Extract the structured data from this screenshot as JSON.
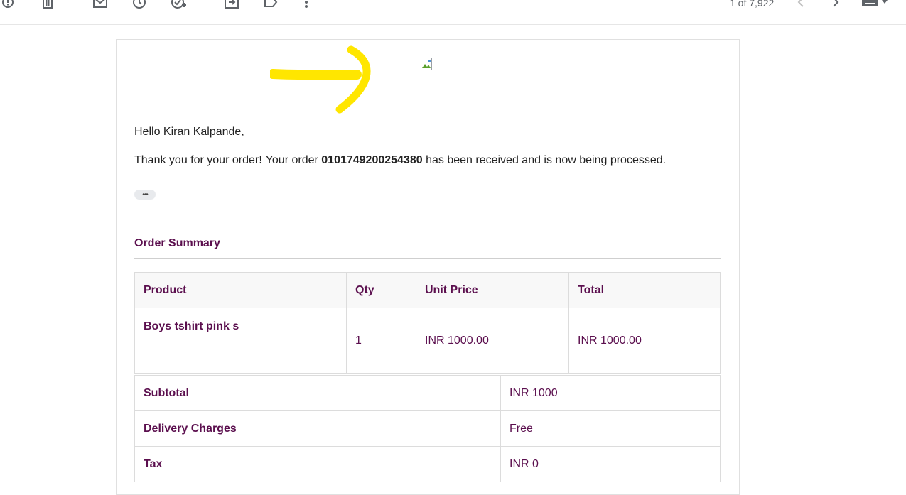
{
  "toolbar": {
    "icons": [
      "report-spam-icon",
      "delete-icon",
      "mark-unread-icon",
      "snooze-icon",
      "add-task-icon",
      "move-to-icon",
      "label-icon",
      "more-icon"
    ],
    "pager_text": "1 of 7,922"
  },
  "email": {
    "greeting": "Hello Kiran Kalpande,",
    "thanks_before": "Thank you for your order",
    "thanks_excl": "!",
    "thanks_mid": " Your order ",
    "order_number": "0101749200254380",
    "thanks_after": " has been received and is now being processed.",
    "more_label": "•••",
    "order_summary_title": "Order Summary",
    "product_table": {
      "headers": [
        "Product",
        "Qty",
        "Unit Price",
        "Total"
      ],
      "rows": [
        {
          "product": "Boys tshirt pink s",
          "qty": "1",
          "unit_price": "INR 1000.00",
          "total": "INR 1000.00"
        }
      ]
    },
    "totals": [
      {
        "label": "Subtotal",
        "value": "INR 1000"
      },
      {
        "label": "Delivery Charges",
        "value": "Free"
      },
      {
        "label": "Tax",
        "value": "INR 0"
      }
    ]
  },
  "colors": {
    "accent_purple": "#5b0f4e",
    "annotation_yellow": "#ffe600"
  }
}
